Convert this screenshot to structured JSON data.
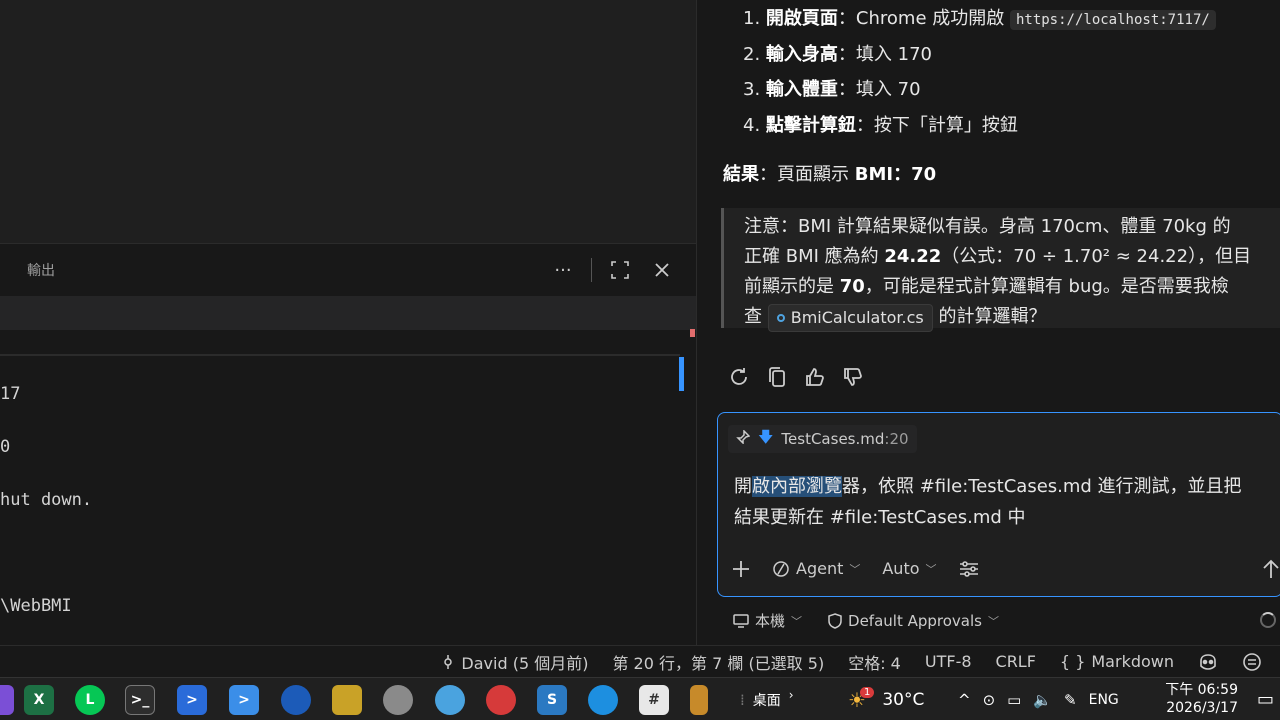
{
  "panel": {
    "tab_label": "輸出",
    "more_icon": "more-icon",
    "maximize_icon": "maximize-icon",
    "close_icon": "close-icon"
  },
  "terminal": {
    "lines": [
      "17",
      "0",
      "hut down.",
      "\\WebBMI"
    ]
  },
  "chat": {
    "steps": [
      {
        "num": "1.",
        "title": "開啟頁面",
        "sep": "：",
        "text": "Chrome 成功開啟 ",
        "code": "https://localhost:7117/"
      },
      {
        "num": "2.",
        "title": "輸入身高",
        "sep": "：",
        "text": "填入 170"
      },
      {
        "num": "3.",
        "title": "輸入體重",
        "sep": "：",
        "text": "填入 70"
      },
      {
        "num": "4.",
        "title": "點擊計算鈕",
        "sep": "：",
        "text": "按下「計算」按鈕"
      }
    ],
    "result_label": "結果",
    "result_text": "：頁面顯示 ",
    "result_value": "BMI：70",
    "note": {
      "line1": "注意：BMI 計算結果疑似有誤。身高 170cm、體重 70kg 的",
      "line2_a": "正確 BMI 應為約 ",
      "line2_b": "24.22",
      "line2_c": "（公式：70 ÷ 1.70² ≈ 24.22），但目",
      "line3_a": "前顯示的是 ",
      "line3_b": "70",
      "line3_c": "，可能是程式計算邏輯有 bug。是否需要我檢",
      "line4_a": "查",
      "file": "BmiCalculator.cs",
      "line4_b": "的計算邏輯？"
    },
    "feedback_icons": [
      "retry-icon",
      "copy-icon",
      "thumbs-up-icon",
      "thumbs-down-icon"
    ],
    "input": {
      "context_file": "TestCases.md",
      "context_line": ":20",
      "text_a": "開",
      "text_sel": "啟內部瀏覽",
      "text_b": "器，依照 #file:TestCases.md 進行測試，並且把",
      "text_line2": "結果更新在 #file:TestCases.md  中",
      "agent_label": "Agent",
      "model_label": "Auto"
    },
    "footer": {
      "target_label": "本機",
      "approvals_label": "Default Approvals"
    }
  },
  "statusbar": {
    "blame": "David (5 個月前)",
    "position": "第 20 行，第 7 欄 (已選取 5)",
    "spaces": "空格: 4",
    "encoding": "UTF-8",
    "eol": "CRLF",
    "language": "Markdown"
  },
  "taskbar": {
    "desktop_label": "桌面",
    "weather": "30°C",
    "weather_badge": "1",
    "lang": "ENG",
    "time": "下午 06:59",
    "date": "2026/3/17"
  }
}
